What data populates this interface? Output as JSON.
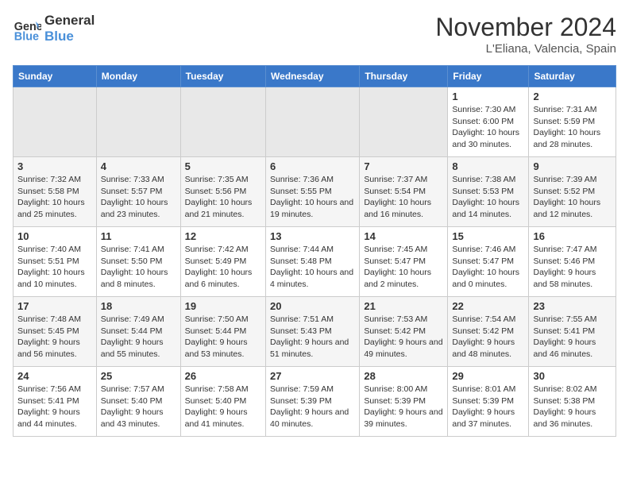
{
  "header": {
    "logo_line1": "General",
    "logo_line2": "Blue",
    "month": "November 2024",
    "location": "L'Eliana, Valencia, Spain"
  },
  "weekdays": [
    "Sunday",
    "Monday",
    "Tuesday",
    "Wednesday",
    "Thursday",
    "Friday",
    "Saturday"
  ],
  "weeks": [
    [
      {
        "day": "",
        "empty": true
      },
      {
        "day": "",
        "empty": true
      },
      {
        "day": "",
        "empty": true
      },
      {
        "day": "",
        "empty": true
      },
      {
        "day": "",
        "empty": true
      },
      {
        "day": "1",
        "sunrise": "7:30 AM",
        "sunset": "6:00 PM",
        "daylight": "10 hours and 30 minutes."
      },
      {
        "day": "2",
        "sunrise": "7:31 AM",
        "sunset": "5:59 PM",
        "daylight": "10 hours and 28 minutes."
      }
    ],
    [
      {
        "day": "3",
        "sunrise": "7:32 AM",
        "sunset": "5:58 PM",
        "daylight": "10 hours and 25 minutes."
      },
      {
        "day": "4",
        "sunrise": "7:33 AM",
        "sunset": "5:57 PM",
        "daylight": "10 hours and 23 minutes."
      },
      {
        "day": "5",
        "sunrise": "7:35 AM",
        "sunset": "5:56 PM",
        "daylight": "10 hours and 21 minutes."
      },
      {
        "day": "6",
        "sunrise": "7:36 AM",
        "sunset": "5:55 PM",
        "daylight": "10 hours and 19 minutes."
      },
      {
        "day": "7",
        "sunrise": "7:37 AM",
        "sunset": "5:54 PM",
        "daylight": "10 hours and 16 minutes."
      },
      {
        "day": "8",
        "sunrise": "7:38 AM",
        "sunset": "5:53 PM",
        "daylight": "10 hours and 14 minutes."
      },
      {
        "day": "9",
        "sunrise": "7:39 AM",
        "sunset": "5:52 PM",
        "daylight": "10 hours and 12 minutes."
      }
    ],
    [
      {
        "day": "10",
        "sunrise": "7:40 AM",
        "sunset": "5:51 PM",
        "daylight": "10 hours and 10 minutes."
      },
      {
        "day": "11",
        "sunrise": "7:41 AM",
        "sunset": "5:50 PM",
        "daylight": "10 hours and 8 minutes."
      },
      {
        "day": "12",
        "sunrise": "7:42 AM",
        "sunset": "5:49 PM",
        "daylight": "10 hours and 6 minutes."
      },
      {
        "day": "13",
        "sunrise": "7:44 AM",
        "sunset": "5:48 PM",
        "daylight": "10 hours and 4 minutes."
      },
      {
        "day": "14",
        "sunrise": "7:45 AM",
        "sunset": "5:47 PM",
        "daylight": "10 hours and 2 minutes."
      },
      {
        "day": "15",
        "sunrise": "7:46 AM",
        "sunset": "5:47 PM",
        "daylight": "10 hours and 0 minutes."
      },
      {
        "day": "16",
        "sunrise": "7:47 AM",
        "sunset": "5:46 PM",
        "daylight": "9 hours and 58 minutes."
      }
    ],
    [
      {
        "day": "17",
        "sunrise": "7:48 AM",
        "sunset": "5:45 PM",
        "daylight": "9 hours and 56 minutes."
      },
      {
        "day": "18",
        "sunrise": "7:49 AM",
        "sunset": "5:44 PM",
        "daylight": "9 hours and 55 minutes."
      },
      {
        "day": "19",
        "sunrise": "7:50 AM",
        "sunset": "5:44 PM",
        "daylight": "9 hours and 53 minutes."
      },
      {
        "day": "20",
        "sunrise": "7:51 AM",
        "sunset": "5:43 PM",
        "daylight": "9 hours and 51 minutes."
      },
      {
        "day": "21",
        "sunrise": "7:53 AM",
        "sunset": "5:42 PM",
        "daylight": "9 hours and 49 minutes."
      },
      {
        "day": "22",
        "sunrise": "7:54 AM",
        "sunset": "5:42 PM",
        "daylight": "9 hours and 48 minutes."
      },
      {
        "day": "23",
        "sunrise": "7:55 AM",
        "sunset": "5:41 PM",
        "daylight": "9 hours and 46 minutes."
      }
    ],
    [
      {
        "day": "24",
        "sunrise": "7:56 AM",
        "sunset": "5:41 PM",
        "daylight": "9 hours and 44 minutes."
      },
      {
        "day": "25",
        "sunrise": "7:57 AM",
        "sunset": "5:40 PM",
        "daylight": "9 hours and 43 minutes."
      },
      {
        "day": "26",
        "sunrise": "7:58 AM",
        "sunset": "5:40 PM",
        "daylight": "9 hours and 41 minutes."
      },
      {
        "day": "27",
        "sunrise": "7:59 AM",
        "sunset": "5:39 PM",
        "daylight": "9 hours and 40 minutes."
      },
      {
        "day": "28",
        "sunrise": "8:00 AM",
        "sunset": "5:39 PM",
        "daylight": "9 hours and 39 minutes."
      },
      {
        "day": "29",
        "sunrise": "8:01 AM",
        "sunset": "5:39 PM",
        "daylight": "9 hours and 37 minutes."
      },
      {
        "day": "30",
        "sunrise": "8:02 AM",
        "sunset": "5:38 PM",
        "daylight": "9 hours and 36 minutes."
      }
    ]
  ]
}
